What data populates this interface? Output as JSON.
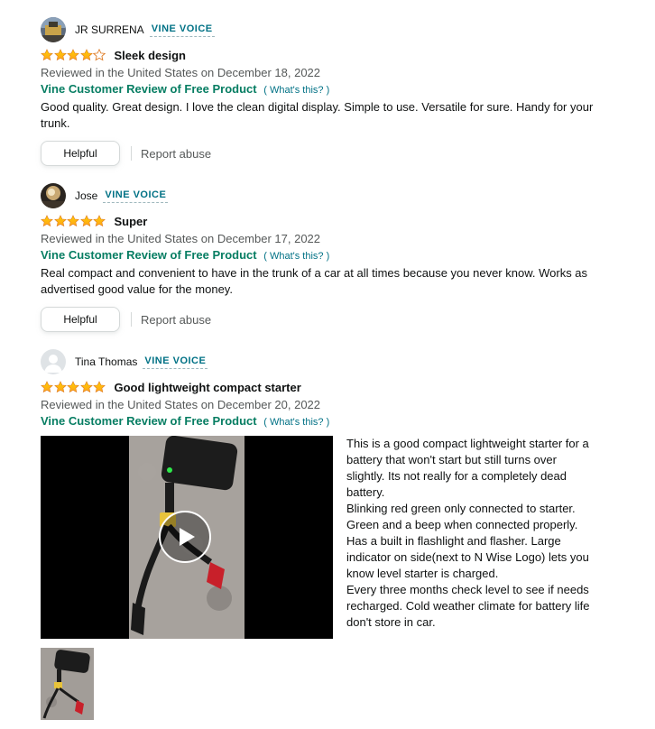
{
  "colors": {
    "star": "#ffa41c",
    "star_stroke": "#de7921",
    "vine_voice": "#007185",
    "vine_label": "#067d62"
  },
  "reviews": [
    {
      "profile_name": "JR SURRENA",
      "badge": "VINE VOICE",
      "rating": 4,
      "title": "Sleek design",
      "meta": "Reviewed in the United States on December 18, 2022",
      "vine_label": "Vine Customer Review of Free Product",
      "whats_this": "( What's this? )",
      "body": "Good quality. Great design. I love the clean digital display. Simple to use. Versatile for sure. Handy for your trunk.",
      "helpful_label": "Helpful",
      "report_label": "Report abuse"
    },
    {
      "profile_name": "Jose",
      "badge": "VINE VOICE",
      "rating": 5,
      "title": "Super",
      "meta": "Reviewed in the United States on December 17, 2022",
      "vine_label": "Vine Customer Review of Free Product",
      "whats_this": "( What's this? )",
      "body": "Real compact and convenient to have in the trunk of a car at all times because you never know. Works as advertised good value for the money.",
      "helpful_label": "Helpful",
      "report_label": "Report abuse"
    },
    {
      "profile_name": "Tina Thomas",
      "badge": "VINE VOICE",
      "rating": 5,
      "title": "Good lightweight compact starter",
      "meta": "Reviewed in the United States on December 20, 2022",
      "vine_label": "Vine Customer Review of Free Product",
      "whats_this": "( What's this? )",
      "body_paragraphs": [
        " This is a good compact lightweight starter for a battery that won't start but still turns over slightly. Its not really for a completely dead battery.",
        "Blinking red green only connected to starter. Green and a beep when connected properly. Has a built in flashlight and flasher. Large indicator on side(next to N Wise Logo) lets you know level starter is charged.",
        "Every three months check level to see if needs recharged. Cold weather climate for battery life don't store in car."
      ]
    }
  ]
}
